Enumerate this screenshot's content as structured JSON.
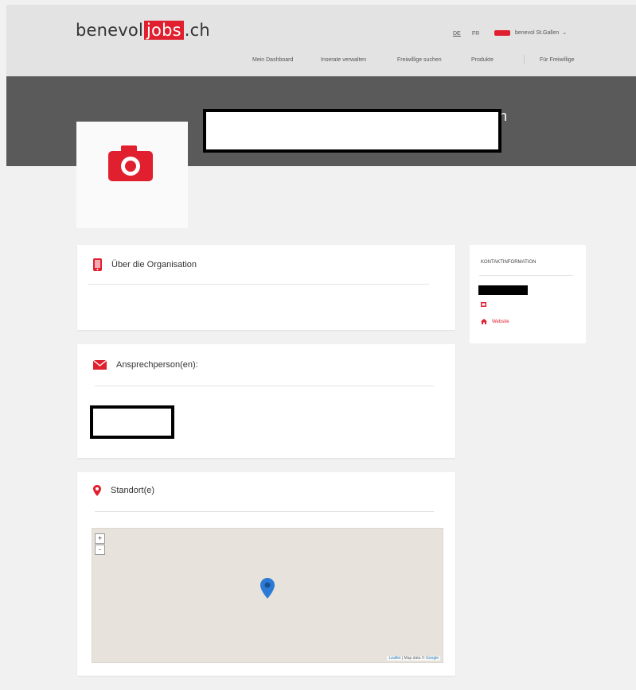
{
  "header": {
    "logo": {
      "pre": "benevol",
      "highlight": "jobs",
      "post": ".ch"
    },
    "languages": [
      "DE",
      "FR"
    ],
    "user_label": "benevol St.Gallen",
    "nav": [
      "Mein Dashboard",
      "Inserate verwalten",
      "Freiwillige suchen",
      "Produkte",
      "Für Freiwillige"
    ]
  },
  "hero": {
    "title_tail": "n"
  },
  "about": {
    "title": "Über die Organisation"
  },
  "contact_persons": {
    "title": "Ansprechperson(en):"
  },
  "location": {
    "title": "Standort(e)",
    "zoom_in": "+",
    "zoom_out": "-",
    "attribution_leaflet": "Leaflet",
    "attribution_sep": " | Map data © ",
    "attribution_google": "Google"
  },
  "sidebar": {
    "title": "KONTAKTINFORMATION",
    "website_label": "Website"
  },
  "colors": {
    "accent": "#e0202f",
    "hero_bg": "#5a5a5a",
    "page_bg": "#f1f1f1"
  },
  "icons": [
    "camera-icon",
    "phone-icon",
    "envelope-icon",
    "map-marker-icon",
    "home-icon",
    "mail-icon"
  ]
}
